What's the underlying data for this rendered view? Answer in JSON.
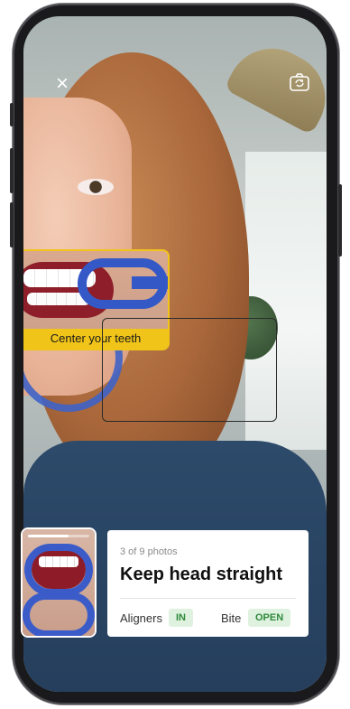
{
  "overlay": {
    "guide_label": "Center your teeth"
  },
  "icons": {
    "close": "×",
    "camera_switch": "camera-switch-icon"
  },
  "capture": {
    "count_text": "3 of 9 photos",
    "progress_fraction": 0.6667,
    "instruction": "Keep head straight",
    "aligners_label": "Aligners",
    "aligners_value": "IN",
    "bite_label": "Bite",
    "bite_value": "OPEN"
  },
  "colors": {
    "guide": "#f0c419",
    "status_text": "#2f8a3c",
    "status_bg": "#dff2df"
  }
}
